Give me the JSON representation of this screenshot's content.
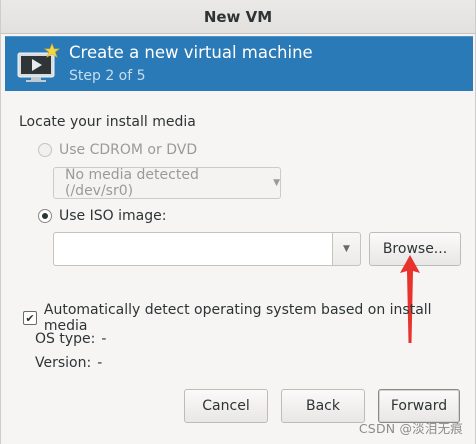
{
  "window": {
    "title": "New VM"
  },
  "banner": {
    "heading": "Create a new virtual machine",
    "step": "Step 2 of 5"
  },
  "install_media": {
    "section_label": "Locate your install media",
    "cdrom_option": "Use CDROM or DVD",
    "cdrom_combo_value": "No media detected (/dev/sr0)",
    "iso_option": "Use ISO image:",
    "iso_path_value": "",
    "browse_label": "Browse..."
  },
  "auto_detect": {
    "label": "Automatically detect operating system based on install media",
    "checked": true
  },
  "os_info": {
    "type_label": "OS type:",
    "type_value": "-",
    "version_label": "Version:",
    "version_value": "-"
  },
  "buttons": {
    "cancel": "Cancel",
    "back": "Back",
    "forward": "Forward"
  },
  "annotation": {
    "color": "#e8322c",
    "icon": "red-arrow-pointing-up"
  },
  "watermark": "CSDN @淡泪无痕",
  "colors": {
    "banner": "#2a7ab8",
    "text": "#2e3436",
    "disabled_text": "#9b9a98"
  }
}
